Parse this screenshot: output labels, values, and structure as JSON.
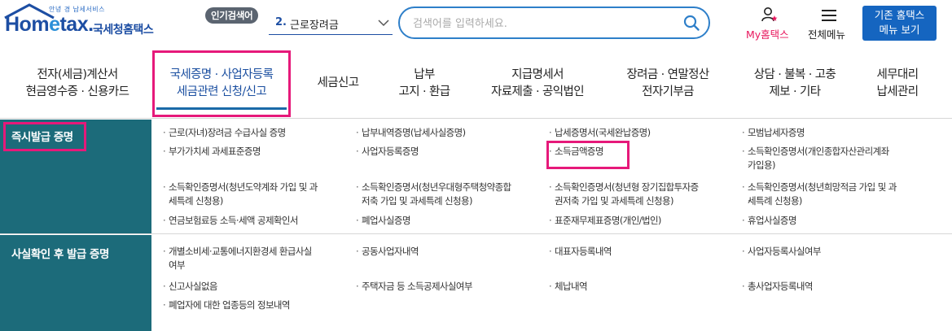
{
  "header": {
    "logo_tag": "안녕 경 납세서비스",
    "logo_main_1": "Hom",
    "logo_main_e": "e",
    "logo_main_2": "tax.",
    "logo_kr": "국세청홈택스",
    "popular_label": "인기검색어",
    "popular_num": "2.",
    "popular_value": "근로장려금",
    "search_placeholder": "검색어를 입력하세요.",
    "myhome_label": "My홈택스",
    "allmenu_label": "전체메뉴",
    "legacy_line1": "기존 홈택스",
    "legacy_line2": "메뉴 보기",
    "colors": {
      "brand": "#1d4ea3",
      "accent": "#e6197a",
      "button": "#1565c0",
      "sidebar": "#1c6b7a"
    }
  },
  "gnb": [
    {
      "line1": "전자(세금)계산서",
      "line2": "현금영수증 · 신용카드"
    },
    {
      "line1": "국세증명 · 사업자등록",
      "line2": "세금관련 신청/신고"
    },
    {
      "line1": "세금신고",
      "line2": ""
    },
    {
      "line1": "납부",
      "line2": "고지 · 환급"
    },
    {
      "line1": "지급명세서",
      "line2": "자료제출 · 공익법인"
    },
    {
      "line1": "장려금 · 연말정산",
      "line2": "전자기부금"
    },
    {
      "line1": "상담 · 불복 · 고충",
      "line2": "제보 · 기타"
    },
    {
      "line1": "세무대리",
      "line2": "납세관리"
    }
  ],
  "sections": [
    {
      "title": "즉시발급 증명",
      "items": [
        "근로(자녀)장려금 수급사실 증명",
        "납부내역증명(납세사실증명)",
        "납세증명서(국세완납증명)",
        "모범납세자증명",
        "부가가치세 과세표준증명",
        "사업자등록증명",
        "소득금액증명",
        "소득확인증명서(개인종합자산관리계좌",
        "가입용)",
        "소득확인증명서(청년도약계좌 가입 및 과",
        "세특례 신청용)",
        "소득확인증명서(청년우대형주택청약종합",
        "저축 가입 및 과세특례 신청용)",
        "소득확인증명서(청년형 장기집합투자증",
        "권저축 가입 및 과세특례 신청용)",
        "소득확인증명서(청년희망적금 가입 및 과",
        "세특례 신청용)",
        "연금보험료등 소득·세액 공제확인서",
        "폐업사실증명",
        "표준재무제표증명(개인/법인)",
        "휴업사실증명"
      ]
    },
    {
      "title": "사실확인 후 발급 증명",
      "items": [
        "개별소비세·교통에너지환경세 환급사실",
        "여부",
        "공동사업자내역",
        "대표자등록내역",
        "사업자등록사실여부",
        "신고사실없음",
        "주택자금 등 소득공제사실여부",
        "체납내역",
        "총사업자등록내역",
        "폐업자에 대한 업종등의 정보내역"
      ]
    }
  ]
}
